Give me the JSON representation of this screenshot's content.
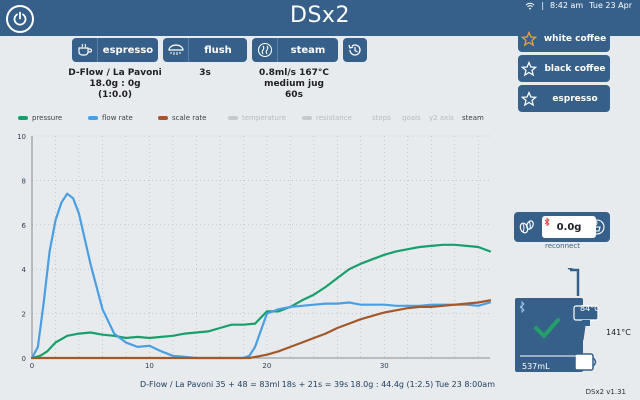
{
  "header": {
    "title": "DSx2",
    "time": "8:42 am",
    "date": "Tue 23 Apr"
  },
  "buttons": {
    "espresso": "espresso",
    "flush": "flush",
    "steam": "steam"
  },
  "espresso_info": {
    "line1": "D-Flow / La Pavoni",
    "line2": "18.0g  :  0g",
    "line3": "(1:0.0)"
  },
  "flush_info": {
    "line1": "3s"
  },
  "steam_info": {
    "line1": "0.8ml/s   167°C",
    "line2": "medium jug",
    "line3": "60s"
  },
  "favourites": [
    {
      "label": "white coffee",
      "active": true
    },
    {
      "label": "black coffee",
      "active": false
    },
    {
      "label": "espresso",
      "active": false
    }
  ],
  "legend": {
    "pressure": "pressure",
    "flow_rate": "flow rate",
    "scale_rate": "scale rate",
    "temperature": "temperature",
    "resistance": "resistance",
    "steps": "steps",
    "goals": "goals",
    "y2_axis": "y2 axis",
    "steam": "steam"
  },
  "colors": {
    "accent": "#36608a",
    "pressure": "#17a06b",
    "flow": "#4a9fe3",
    "scale": "#a4582a",
    "check": "#23a06a"
  },
  "chart_data": {
    "type": "line",
    "xlim": [
      0,
      39
    ],
    "ylim": [
      0,
      10
    ],
    "xticks": [
      0,
      10,
      20,
      30
    ],
    "yticks": [
      0,
      2,
      4,
      6,
      8,
      10
    ],
    "grid": true,
    "legend_placement": "top",
    "series": [
      {
        "name": "pressure",
        "color": "#17a06b",
        "x": [
          0,
          0.7,
          1.3,
          2,
          3,
          4,
          5,
          6,
          7,
          8,
          9,
          10,
          11,
          12,
          13,
          14,
          15,
          16,
          17,
          18,
          19,
          20,
          21,
          22,
          23,
          24,
          25,
          26,
          27,
          28,
          29,
          30,
          31,
          32,
          33,
          34,
          35,
          36,
          37,
          38,
          39
        ],
        "y": [
          0,
          0.1,
          0.3,
          0.7,
          1.0,
          1.1,
          1.15,
          1.05,
          1.0,
          0.9,
          0.95,
          0.9,
          0.95,
          1.0,
          1.1,
          1.15,
          1.2,
          1.35,
          1.5,
          1.5,
          1.55,
          2.1,
          2.1,
          2.3,
          2.6,
          2.85,
          3.2,
          3.6,
          4.0,
          4.25,
          4.45,
          4.65,
          4.8,
          4.9,
          5.0,
          5.05,
          5.1,
          5.1,
          5.05,
          5.0,
          4.8
        ]
      },
      {
        "name": "flow rate",
        "color": "#4a9fe3",
        "x": [
          0,
          0.5,
          1,
          1.5,
          2,
          2.5,
          3,
          3.5,
          4,
          5,
          6,
          7,
          8,
          9,
          10,
          11,
          12,
          13,
          14,
          15,
          16,
          17,
          18,
          18.5,
          19,
          20,
          21,
          22,
          23,
          24,
          25,
          26,
          27,
          28,
          29,
          30,
          31,
          32,
          33,
          34,
          35,
          36,
          37,
          38,
          39
        ],
        "y": [
          0,
          0.5,
          2.5,
          4.8,
          6.2,
          7.0,
          7.4,
          7.2,
          6.5,
          4.2,
          2.2,
          1.1,
          0.7,
          0.5,
          0.55,
          0.3,
          0.1,
          0.05,
          0,
          0,
          0,
          0,
          0,
          0.1,
          0.5,
          2.0,
          2.2,
          2.3,
          2.35,
          2.4,
          2.45,
          2.45,
          2.5,
          2.4,
          2.4,
          2.4,
          2.35,
          2.35,
          2.35,
          2.4,
          2.4,
          2.4,
          2.4,
          2.35,
          2.5
        ]
      },
      {
        "name": "scale rate",
        "color": "#a4582a",
        "x": [
          0,
          5,
          10,
          15,
          18.5,
          19,
          20,
          21,
          22,
          23,
          24,
          25,
          26,
          27,
          28,
          29,
          30,
          31,
          32,
          33,
          34,
          35,
          36,
          37,
          38,
          39
        ],
        "y": [
          0,
          0,
          0,
          0,
          0,
          0.05,
          0.15,
          0.3,
          0.5,
          0.7,
          0.9,
          1.1,
          1.35,
          1.55,
          1.75,
          1.9,
          2.05,
          2.15,
          2.25,
          2.3,
          2.3,
          2.35,
          2.4,
          2.45,
          2.5,
          2.6
        ]
      }
    ]
  },
  "footer": {
    "profile": "D-Flow / La Pavoni",
    "volume": "35 + 48 = 83ml",
    "time": "18s + 21s = 39s",
    "ratio": "18.0g : 44.4g (1:2.5)",
    "date": "Tue 23 8:00am"
  },
  "scale": {
    "weight": "0.0g",
    "status": "reconnect"
  },
  "machine": {
    "group_temp": "84°C",
    "steam_temp": "141°C",
    "water": "537mL"
  },
  "version": "DSx2 v1.31"
}
